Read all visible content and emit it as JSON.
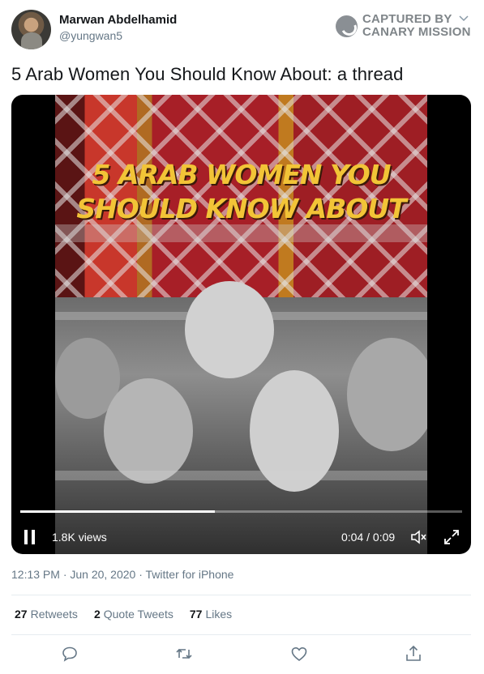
{
  "author": {
    "display_name": "Marwan Abdelhamid",
    "handle": "@yungwan5"
  },
  "watermark": {
    "line1": "CAPTURED BY",
    "line2": "CANARY MISSION"
  },
  "tweet": {
    "text": "5 Arab Women You Should Know About: a thread"
  },
  "video": {
    "headline_line1": "5 ARAB WOMEN YOU",
    "headline_line2": "SHOULD KNOW ABOUT",
    "views": "1.8K views",
    "time": "0:04 / 0:09",
    "progress": 0.44
  },
  "meta": {
    "timestamp": "12:13 PM · Jun 20, 2020 · Twitter for iPhone"
  },
  "stats": {
    "retweets_count": "27",
    "retweets_label": "Retweets",
    "quotes_count": "2",
    "quotes_label": "Quote Tweets",
    "likes_count": "77",
    "likes_label": "Likes"
  },
  "icons": {
    "reply": "reply-icon",
    "retweet": "retweet-icon",
    "like": "heart-icon",
    "share": "share-icon"
  },
  "colors": {
    "headline": "#f2c437",
    "secondary_text": "#657786"
  }
}
